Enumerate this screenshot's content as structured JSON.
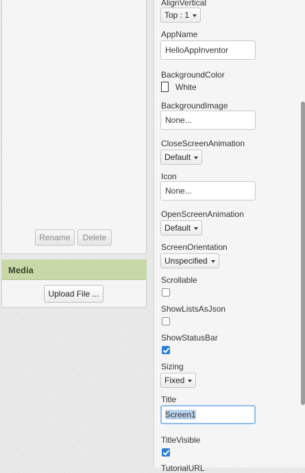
{
  "components": {
    "rename_label": "Rename",
    "delete_label": "Delete"
  },
  "media": {
    "header": "Media",
    "upload_label": "Upload File ..."
  },
  "properties": {
    "align_vertical": {
      "label": "AlignVertical",
      "value": "Top : 1"
    },
    "app_name": {
      "label": "AppName",
      "value": "HelloAppInventor"
    },
    "background_color": {
      "label": "BackgroundColor",
      "value": "White",
      "swatch": "#ffffff"
    },
    "background_image": {
      "label": "BackgroundImage",
      "value": "None..."
    },
    "close_screen_animation": {
      "label": "CloseScreenAnimation",
      "value": "Default"
    },
    "icon": {
      "label": "Icon",
      "value": "None..."
    },
    "open_screen_animation": {
      "label": "OpenScreenAnimation",
      "value": "Default"
    },
    "screen_orientation": {
      "label": "ScreenOrientation",
      "value": "Unspecified"
    },
    "scrollable": {
      "label": "Scrollable",
      "checked": false
    },
    "show_lists_as_json": {
      "label": "ShowListsAsJson",
      "checked": false
    },
    "show_status_bar": {
      "label": "ShowStatusBar",
      "checked": true
    },
    "sizing": {
      "label": "Sizing",
      "value": "Fixed"
    },
    "title": {
      "label": "Title",
      "value": "Screen1"
    },
    "title_visible": {
      "label": "TitleVisible",
      "checked": true
    },
    "tutorial_url": {
      "label": "TutorialURL"
    }
  },
  "colors": {
    "media_header": "#c8d8a8",
    "checkbox_checked": "#2d7fd7",
    "focus_border": "#8fbce8"
  }
}
